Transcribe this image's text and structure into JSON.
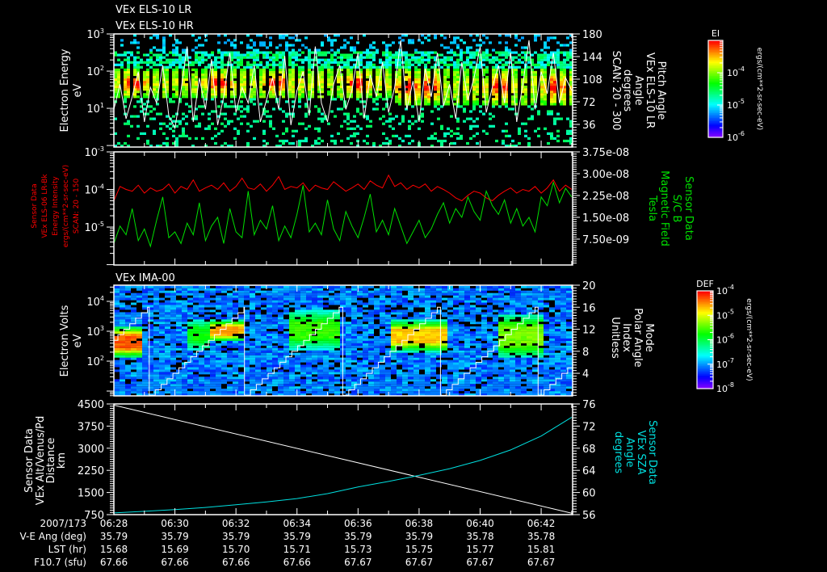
{
  "titles": {
    "els_lr": "VEx ELS-10 LR",
    "els_hr": "VEx ELS-10 HR",
    "ima": "VEx IMA-00"
  },
  "colors": {
    "background": "#000000",
    "axis": "#ffffff",
    "energy_intensity": "#ff0000",
    "magnetic_field": "#00e000",
    "sza": "#00e0e0",
    "line": "#ffffff"
  },
  "panels": [
    {
      "left_label": [
        "Electron Energy",
        "eV"
      ],
      "right_label": [
        "Pitch Angle",
        "VEx ELS-10 LR",
        "Angle",
        "degrees",
        "SCAN: 20 - 300"
      ],
      "left_ticks": [
        {
          "m": "10",
          "e": "3"
        },
        {
          "m": "10",
          "e": "2"
        },
        {
          "m": "10",
          "e": "1"
        }
      ],
      "right_ticks": [
        "180",
        "144",
        "108",
        "72",
        "36"
      ]
    },
    {
      "left_label": [
        "Sensor Data",
        "VEx ELS-06 LR-Bk",
        "Energy Intensity",
        "ergs/(cm**2-sr-sec-eV)",
        "SCAN: 20 - 150"
      ],
      "right_label": [
        "Sensor Data",
        "S/C B",
        "Magnetic Field",
        "Tesla"
      ],
      "left_ticks": [
        {
          "m": "10",
          "e": "-3"
        },
        {
          "m": "10",
          "e": "-4"
        },
        {
          "m": "10",
          "e": "-5"
        }
      ],
      "right_ticks": [
        "3.75e-08",
        "3.00e-08",
        "2.25e-08",
        "1.50e-08",
        "7.50e-09"
      ]
    },
    {
      "left_label": [
        "Electron Volts",
        "eV"
      ],
      "right_label": [
        "Mode",
        "Polar Angle",
        "Index",
        "Unitless"
      ],
      "left_ticks": [
        {
          "m": "10",
          "e": "4"
        },
        {
          "m": "10",
          "e": "3"
        },
        {
          "m": "10",
          "e": "2"
        }
      ],
      "right_ticks": [
        "20",
        "16",
        "12",
        "8",
        "4"
      ]
    },
    {
      "left_label": [
        "Sensor Data",
        "VEx Alt/Venus/Pd",
        "Distance",
        "km"
      ],
      "right_label": [
        "Sensor Data",
        "VEx SZA",
        "Angle",
        "degrees"
      ],
      "left_ticks": [
        "4500",
        "3750",
        "3000",
        "2250",
        "1500",
        "750"
      ],
      "right_ticks": [
        "76",
        "72",
        "68",
        "64",
        "60",
        "56"
      ]
    }
  ],
  "colorbars": [
    {
      "title": "EI",
      "units": "ergs/(cm**2-sr-sec-eV)",
      "ticks": [
        {
          "m": "10",
          "e": "-4"
        },
        {
          "m": "10",
          "e": "-5"
        },
        {
          "m": "10",
          "e": "-6"
        }
      ],
      "tick_values": [
        0.0001,
        1e-05,
        1e-06
      ],
      "range": [
        1e-06,
        0.001
      ]
    },
    {
      "title": "DEF",
      "units": "ergs/(cm**2-sr-sec-eV)",
      "ticks": [
        {
          "m": "10",
          "e": "-4"
        },
        {
          "m": "10",
          "e": "-5"
        },
        {
          "m": "10",
          "e": "-6"
        },
        {
          "m": "10",
          "e": "-7"
        },
        {
          "m": "10",
          "e": "-8"
        }
      ],
      "tick_values": [
        0.0001,
        1e-05,
        1e-06,
        1e-07,
        1e-08
      ],
      "range": [
        1e-08,
        0.0001
      ]
    }
  ],
  "time_table": {
    "rows": [
      {
        "label": "2007/173",
        "values": [
          "06:28",
          "06:30",
          "06:32",
          "06:34",
          "06:36",
          "06:38",
          "06:40",
          "06:42"
        ]
      },
      {
        "label": "V-E Ang (deg)",
        "values": [
          "35.79",
          "35.79",
          "35.79",
          "35.79",
          "35.79",
          "35.79",
          "35.78",
          "35.78"
        ]
      },
      {
        "label": "LST (hr)",
        "values": [
          "15.68",
          "15.69",
          "15.70",
          "15.71",
          "15.73",
          "15.75",
          "15.77",
          "15.81"
        ]
      },
      {
        "label": "F10.7 (sfu)",
        "values": [
          "67.66",
          "67.66",
          "67.66",
          "67.66",
          "67.67",
          "67.67",
          "67.67",
          "67.67"
        ]
      }
    ]
  },
  "chart_data": [
    {
      "type": "heatmap",
      "title": "VEx ELS-10 LR / VEx ELS-10 HR",
      "x_unit": "minutes after 06:28",
      "x_range": [
        0,
        15.03
      ],
      "x_major_step_min": 2,
      "ylabel": "Electron Energy (eV)",
      "y_scale": "log",
      "y_range": [
        0.91,
        1000
      ],
      "y_tick_values": [
        1000,
        100,
        10
      ],
      "y2label": "Pitch Angle (degrees)",
      "y2_range": [
        0,
        180
      ],
      "y2_tick_values": [
        180,
        144,
        108,
        72,
        36
      ],
      "peak_band_eV": [
        17,
        110
      ],
      "peak_band_eV_after_0637": [
        11,
        110
      ],
      "hot_times_min": [
        0.6,
        3.4,
        5.3,
        7.9,
        9.6,
        10.3,
        12.6,
        14.4
      ],
      "pitch_angle_sample_step_min": 0.2,
      "pitch_angle_deg": [
        60,
        100,
        45,
        80,
        120,
        40,
        95,
        70,
        130,
        50,
        30,
        90,
        160,
        40,
        110,
        60,
        140,
        35,
        80,
        150,
        55,
        95,
        70,
        130,
        40,
        75,
        110,
        60,
        145,
        35,
        90,
        120,
        50,
        160,
        70,
        40,
        100,
        130,
        60,
        90,
        150,
        45,
        115,
        80,
        135,
        55,
        95,
        170,
        60,
        105,
        40,
        125,
        80,
        150,
        65,
        100,
        45,
        135,
        75,
        110,
        160,
        55,
        95,
        130,
        70,
        150,
        40,
        100,
        170,
        60,
        120,
        85,
        150,
        70,
        110,
        90
      ]
    },
    {
      "type": "line",
      "x_unit": "minutes after 06:28",
      "x_range": [
        0,
        15.03
      ],
      "sample_step_min": 0.2,
      "ylabel": "Energy Intensity ergs/(cm**2-sr-sec-eV)",
      "y_scale": "log",
      "y_range": [
        9.8e-07,
        0.001
      ],
      "y_tick_values": [
        0.001,
        0.0001,
        1e-05
      ],
      "y2label": "Magnetic Field (Tesla)",
      "y2_range": [
        -1.4e-09,
        3.75e-08
      ],
      "y2_tick_values": [
        3.75e-08,
        3e-08,
        2.25e-08,
        1.5e-08,
        7.5e-09
      ],
      "series": [
        {
          "name": "VEx ELS-06 LR-Bk Energy Intensity",
          "axis": "left",
          "color": "#ff0000",
          "scale": 1e-05,
          "values": [
            5,
            12,
            10,
            9,
            13,
            8,
            11,
            9,
            10,
            14,
            8,
            12,
            10,
            18,
            9,
            11,
            13,
            10,
            15,
            9,
            12,
            20,
            11,
            10,
            14,
            9,
            13,
            22,
            10,
            12,
            11,
            15,
            9,
            13,
            11,
            10,
            16,
            12,
            9,
            11,
            14,
            10,
            17,
            13,
            11,
            24,
            12,
            15,
            10,
            13,
            11,
            14,
            9,
            12,
            10,
            8,
            6,
            5,
            7,
            9,
            8,
            6,
            5,
            7,
            9,
            11,
            8,
            10,
            9,
            12,
            8,
            11,
            18,
            9,
            13,
            10
          ]
        },
        {
          "name": "S/C B Magnetic Field",
          "axis": "right",
          "color": "#00e000",
          "scale": 1e-09,
          "values": [
            6,
            12,
            9,
            18,
            7,
            11,
            5,
            14,
            22,
            8,
            10,
            6,
            13,
            9,
            20,
            7,
            12,
            15,
            6,
            18,
            10,
            8,
            24,
            9,
            14,
            11,
            19,
            7,
            12,
            8,
            16,
            26,
            10,
            13,
            9,
            21,
            11,
            7,
            17,
            12,
            8,
            15,
            23,
            10,
            14,
            9,
            18,
            12,
            6,
            10,
            14,
            8,
            11,
            16,
            20,
            13,
            18,
            15,
            22,
            17,
            14,
            24,
            19,
            16,
            21,
            13,
            18,
            12,
            15,
            10,
            22,
            19,
            27,
            20,
            25,
            22
          ]
        }
      ]
    },
    {
      "type": "heatmap",
      "title": "VEx IMA-00",
      "x_unit": "minutes after 06:28",
      "x_range": [
        0,
        15.03
      ],
      "ylabel": "Electron Volts (eV)",
      "y_scale": "log",
      "y_range": [
        6.9,
        34700
      ],
      "y_tick_values": [
        10000,
        1000,
        100
      ],
      "y2label": "Mode Polar Angle Index",
      "y2_range": [
        -0.1,
        20
      ],
      "y2_tick_values": [
        20,
        16,
        12,
        8,
        4
      ],
      "mode_index_max": 16,
      "mode_ramp_minutes": 3.1,
      "mode_resets_min": [
        -2.0,
        1.16,
        4.28,
        7.5,
        10.7,
        13.9
      ],
      "bursts": [
        {
          "start": 0.0,
          "end": 0.9,
          "log_eV": [
            2.2,
            3.0
          ],
          "level": 0.92
        },
        {
          "start": 2.4,
          "end": 3.1,
          "log_eV": [
            2.5,
            3.2
          ],
          "level": 0.55
        },
        {
          "start": 3.1,
          "end": 4.1,
          "log_eV": [
            2.75,
            3.2
          ],
          "level": 0.85
        },
        {
          "start": 5.6,
          "end": 7.4,
          "log_eV": [
            2.5,
            3.5
          ],
          "level": 0.6
        },
        {
          "start": 9.0,
          "end": 10.9,
          "log_eV": [
            2.4,
            3.2
          ],
          "level": 0.82
        },
        {
          "start": 12.5,
          "end": 14.0,
          "log_eV": [
            2.2,
            3.4
          ],
          "level": 0.66
        }
      ]
    },
    {
      "type": "line",
      "x_unit": "minutes after 06:28",
      "x_range": [
        0,
        15.03
      ],
      "ylabel": "VEx Alt/Venus/Pd Distance (km)",
      "y_range": [
        750,
        4500
      ],
      "y_tick_values": [
        4500,
        3750,
        3000,
        2250,
        1500,
        750
      ],
      "y2label": "VEx SZA Angle (degrees)",
      "y2_range": [
        56,
        76
      ],
      "y2_tick_values": [
        76,
        72,
        68,
        64,
        60,
        56
      ],
      "series": [
        {
          "name": "VEx Alt/Venus/Pd Distance",
          "axis": "left",
          "color": "#ffffff",
          "x": [
            0,
            15.03
          ],
          "values": [
            4460,
            790
          ]
        },
        {
          "name": "VEx SZA",
          "axis": "right",
          "color": "#00e0e0",
          "x": [
            0,
            1,
            2,
            3,
            4,
            5,
            6,
            7,
            8,
            9,
            10,
            11,
            12,
            13,
            14,
            15
          ],
          "values": [
            56.3,
            56.6,
            56.9,
            57.3,
            57.8,
            58.3,
            58.9,
            59.8,
            61.0,
            62.0,
            63.1,
            64.3,
            65.8,
            67.7,
            70.2,
            73.6
          ]
        }
      ]
    }
  ]
}
